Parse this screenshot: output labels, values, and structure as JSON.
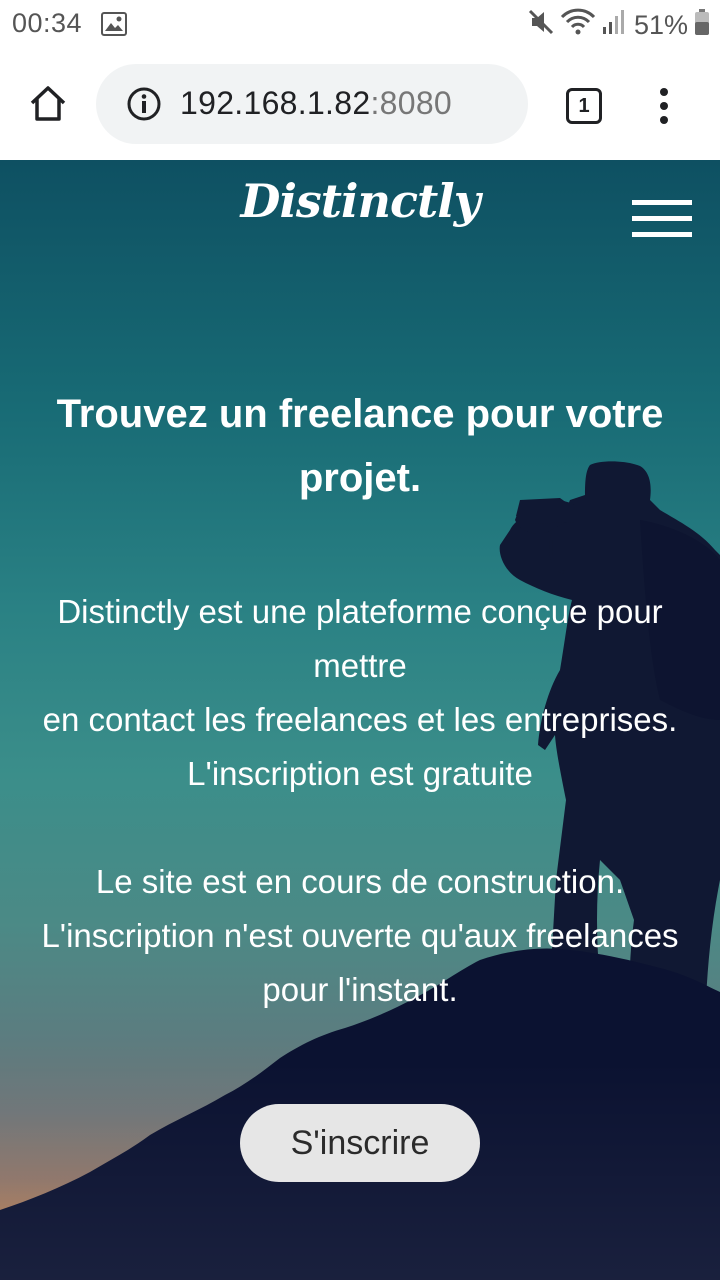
{
  "status_bar": {
    "time": "00:34",
    "battery_percent": "51%",
    "icons": [
      "gallery-icon",
      "mute-icon",
      "wifi-icon",
      "signal-icon",
      "battery-icon"
    ]
  },
  "browser": {
    "url_host": "192.168.1.82",
    "url_port": ":8080",
    "tab_count": "1"
  },
  "page": {
    "brand": "Distinctly",
    "headline": "Trouvez un freelance pour votre projet.",
    "description_lines": [
      "Distinctly est une plateforme conçue pour",
      "mettre",
      "en contact les freelances et les entreprises.",
      "L'inscription est gratuite"
    ],
    "notice_lines": [
      "Le site est en cours de construction.",
      "L'inscription n'est ouverte qu'aux freelances",
      "pour l'instant."
    ],
    "signup_label": "S'inscrire"
  },
  "colors": {
    "hero_top": "#0e5062",
    "hero_mid": "#3b8e8a",
    "hero_bottom": "#c88752",
    "silhouette": "#101833",
    "button_bg": "#e6e6e6"
  }
}
